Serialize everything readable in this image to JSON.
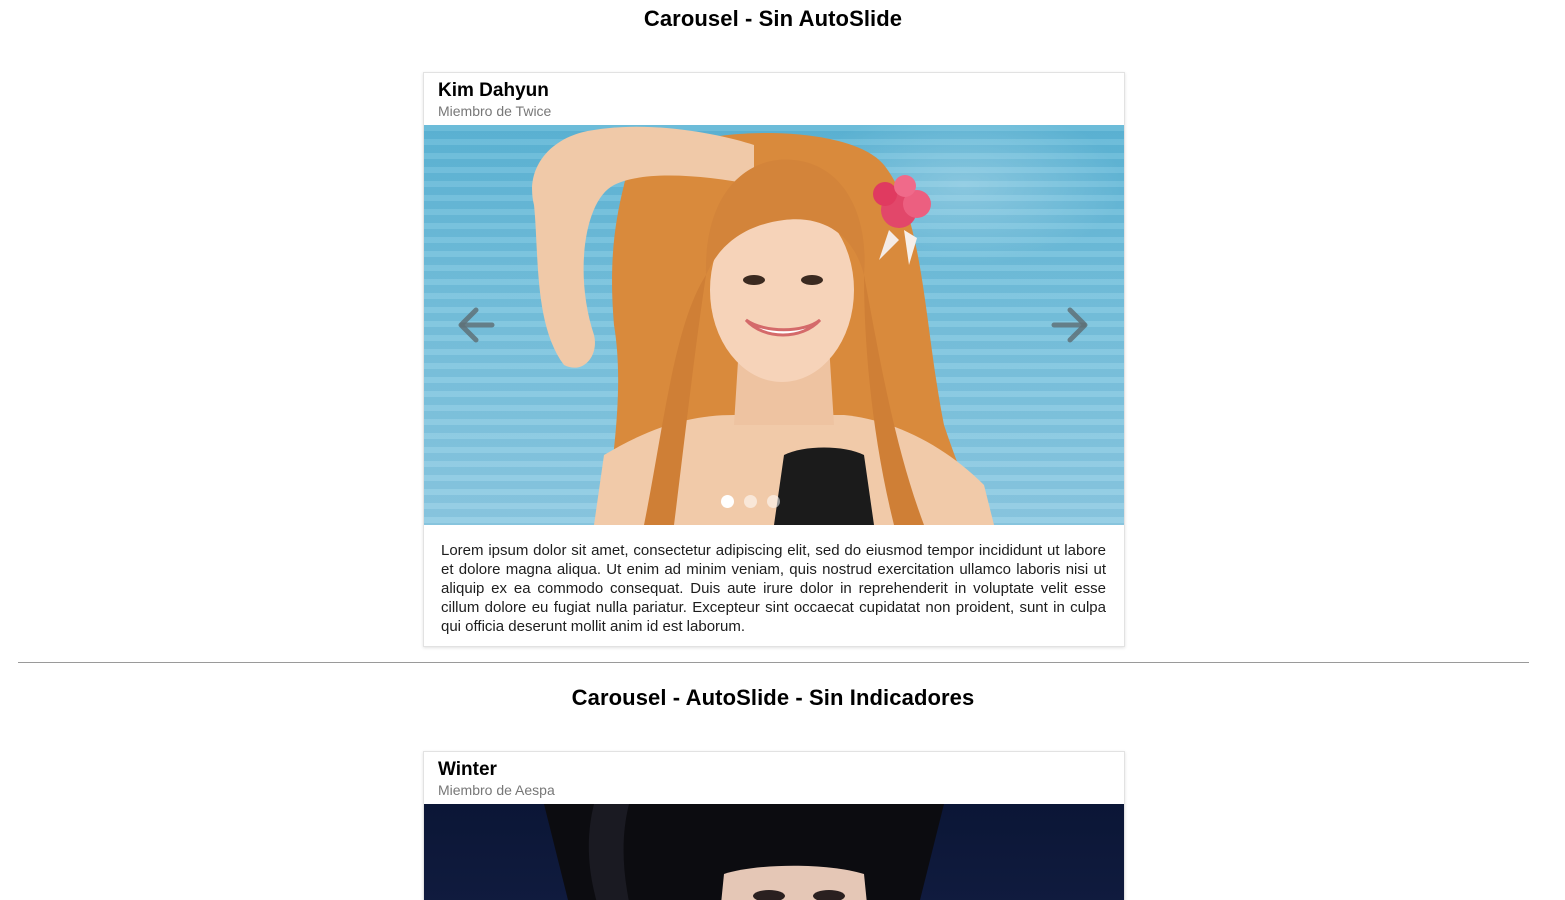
{
  "sections": [
    {
      "title": "Carousel - Sin AutoSlide",
      "card": {
        "name": "Kim Dahyun",
        "subtitle": "Miembro de Twice",
        "body": "Lorem ipsum dolor sit amet, consectetur adipiscing elit, sed do eiusmod tempor incididunt ut labore et dolore magna aliqua. Ut enim ad minim veniam, quis nostrud exercitation ullamco laboris nisi ut aliquip ex ea commodo consequat. Duis aute irure dolor in reprehenderit in voluptate velit esse cillum dolore eu fugiat nulla pariatur. Excepteur sint occaecat cupidatat non proident, sunt in culpa qui officia deserunt mollit anim id est laborum.",
        "indicators": {
          "count": 3,
          "active": 0
        },
        "prev_icon": "arrow-left-icon",
        "next_icon": "arrow-right-icon"
      }
    },
    {
      "title": "Carousel - AutoSlide - Sin Indicadores",
      "card": {
        "name": "Winter",
        "subtitle": "Miembro de Aespa"
      }
    }
  ],
  "colors": {
    "arrow": "#5e7178",
    "divider": "#9a9a9a",
    "subtitle": "#777777"
  }
}
